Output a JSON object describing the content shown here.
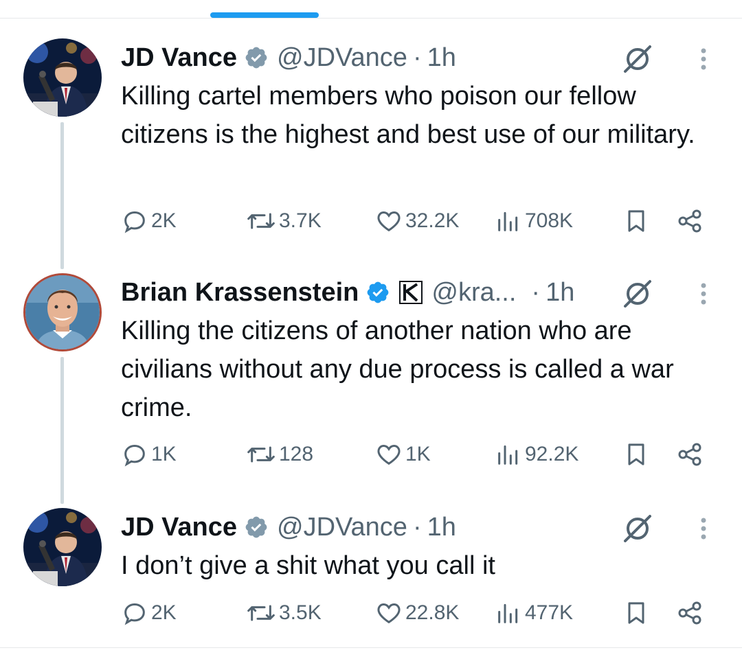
{
  "tweets": [
    {
      "name": "JD Vance",
      "handle": "@JDVance",
      "dot": "·",
      "time": "1h",
      "text": "Killing cartel members who poison our fellow citizens is the highest and best use of our military.",
      "replies": "2K",
      "reposts": "3.7K",
      "likes": "32.2K",
      "views": "708K",
      "verified_color": "#829aab"
    },
    {
      "name": "Brian Krassenstein",
      "handle": "@kra...",
      "dot": "·",
      "time": "1h",
      "text": "Killing the citizens of another nation who are civilians without any due process is called a war crime.",
      "replies": "1K",
      "reposts": "128",
      "likes": "1K",
      "views": "92.2K",
      "verified_color": "#1d9bf0"
    },
    {
      "name": "JD Vance",
      "handle": "@JDVance",
      "dot": "·",
      "time": "1h",
      "text": "I don’t give a shit what you call it",
      "replies": "2K",
      "reposts": "3.5K",
      "likes": "22.8K",
      "views": "477K",
      "verified_color": "#829aab"
    }
  ],
  "icons": {
    "reply": "reply-icon",
    "repost": "repost-icon",
    "like": "heart-icon",
    "views": "views-icon",
    "bookmark": "bookmark-icon",
    "share": "share-icon",
    "grok": "grok-icon",
    "more": "more-icon"
  },
  "colors": {
    "accent": "#1d9bf0",
    "text": "#0f1419",
    "secondary": "#536471",
    "thread_line": "#cfd9de"
  }
}
